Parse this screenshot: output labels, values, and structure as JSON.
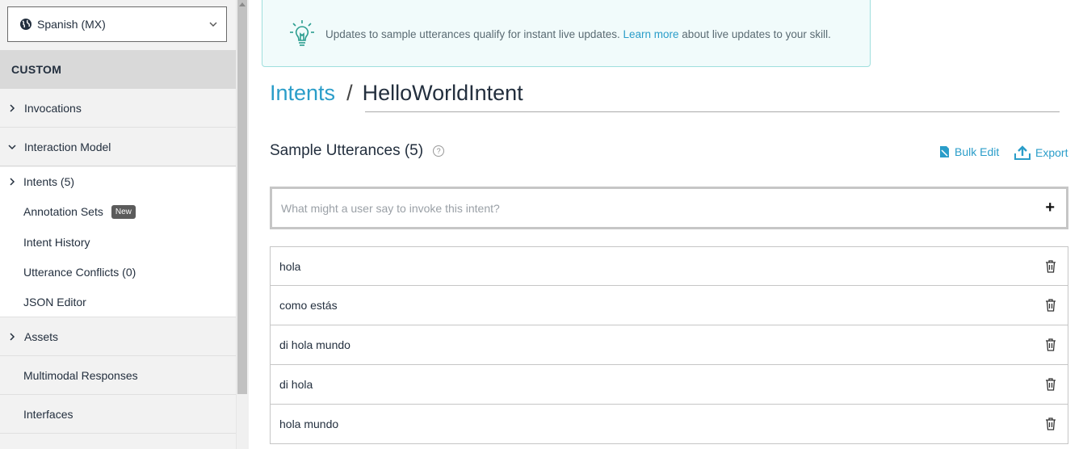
{
  "sidebar": {
    "locale": "Spanish (MX)",
    "section": "CUSTOM",
    "items": [
      {
        "label": "Invocations"
      },
      {
        "label": "Interaction Model"
      }
    ],
    "subitems": [
      {
        "label": "Intents (5)"
      },
      {
        "label": "Annotation Sets",
        "badge": "New"
      },
      {
        "label": "Intent History"
      },
      {
        "label": "Utterance Conflicts (0)"
      },
      {
        "label": "JSON Editor"
      }
    ],
    "lower_items": [
      {
        "label": "Assets"
      },
      {
        "label": "Multimodal Responses"
      },
      {
        "label": "Interfaces"
      }
    ]
  },
  "banner": {
    "text_before": "Updates to sample utterances qualify for instant live updates.",
    "link": "Learn more",
    "text_after": "about live updates to your skill."
  },
  "breadcrumb": {
    "link": "Intents",
    "separator": "/",
    "current": "HelloWorldIntent"
  },
  "utterances_section": {
    "title": "Sample Utterances (5)",
    "help": "?",
    "bulk_edit": "Bulk Edit",
    "export": "Export",
    "placeholder": "What might a user say to invoke this intent?",
    "add": "+"
  },
  "utterances": [
    "hola",
    "como estás",
    "di hola mundo",
    "di hola",
    "hola mundo"
  ],
  "colors": {
    "accent": "#2a9dc9",
    "banner_bg": "#f1fbfb",
    "banner_border": "#9fdfdd",
    "sidebar_bg": "#f2f2f2"
  }
}
